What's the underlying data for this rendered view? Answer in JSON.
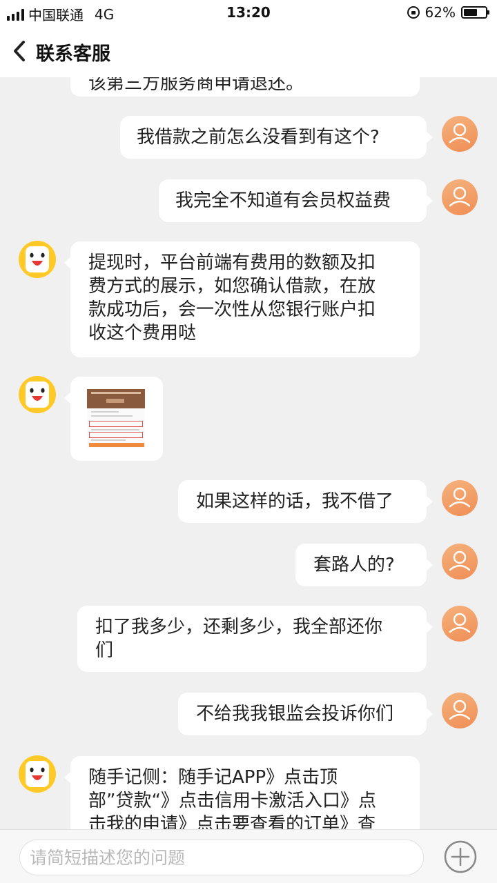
{
  "status_bar": {
    "carrier": "中国联通",
    "network": "4G",
    "time": "13:20",
    "battery_percent": "62%",
    "battery_level": 0.62
  },
  "nav": {
    "back_icon": "chevron-left-icon",
    "title": "联系客服"
  },
  "messages": [
    {
      "side": "left",
      "type": "text",
      "text": "该第三方服务商申请退还。"
    },
    {
      "side": "right",
      "type": "text",
      "text": "我借款之前怎么没看到有这个?"
    },
    {
      "side": "right",
      "type": "text",
      "text": "我完全不知道有会员权益费"
    },
    {
      "side": "left",
      "type": "text",
      "lines": [
        "提现时，平台前端有费用的数额及扣",
        "费方式的展示，如您确认借款，在放",
        "款成功后，会一次性从您银行账户扣",
        "收这个费用哒"
      ]
    },
    {
      "side": "left",
      "type": "image"
    },
    {
      "side": "right",
      "type": "text",
      "text": "如果这样的话，我不借了"
    },
    {
      "side": "right",
      "type": "text",
      "text": "套路人的?"
    },
    {
      "side": "right",
      "type": "text",
      "lines": [
        "扣了我多少，还剩多少，我全部还你",
        "们"
      ]
    },
    {
      "side": "right",
      "type": "text",
      "text": "不给我我银监会投诉你们"
    },
    {
      "side": "left",
      "type": "text",
      "lines": [
        "随手记侧：随手记APP》点击顶",
        "部”贷款“》点击信用卡激活入口》点",
        "击我的申请》点击要查看的订单》查"
      ]
    }
  ],
  "input": {
    "placeholder": "请简短描述您的问题",
    "plus_icon": "plus-circle-icon"
  },
  "colors": {
    "background": "#f0f0f0",
    "bubble": "#ffffff",
    "user_avatar": "#ef8e55",
    "bot_avatar": "#ffc928"
  }
}
